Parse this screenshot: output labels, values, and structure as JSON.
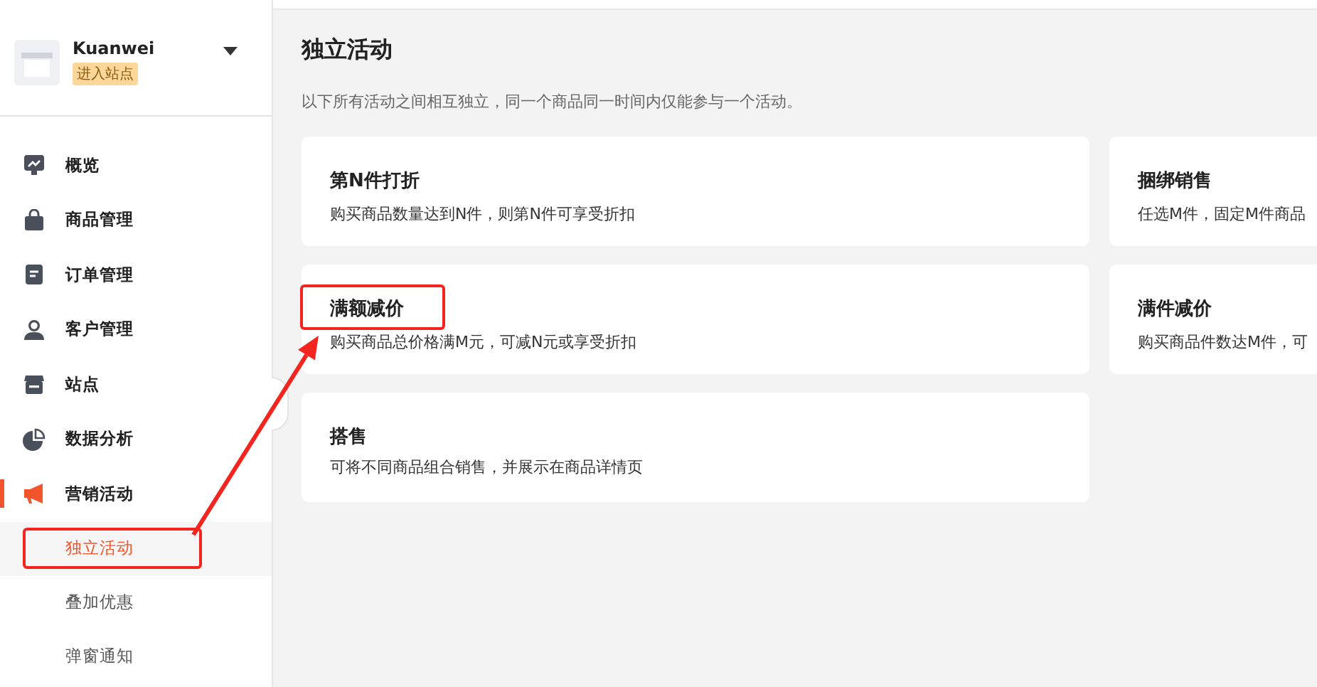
{
  "store": {
    "name": "Kuanwei",
    "badge": "进入站点"
  },
  "nav": [
    {
      "label": "概览",
      "kind": "chart",
      "selected": false
    },
    {
      "label": "商品管理",
      "kind": "bag",
      "selected": false
    },
    {
      "label": "订单管理",
      "kind": "doc",
      "selected": false
    },
    {
      "label": "客户管理",
      "kind": "user",
      "selected": false
    },
    {
      "label": "站点",
      "kind": "shop",
      "selected": false
    },
    {
      "label": "数据分析",
      "kind": "pie",
      "selected": false
    },
    {
      "label": "营销活动",
      "kind": "megaphone",
      "selected": true,
      "children": [
        {
          "label": "独立活动",
          "selected": true,
          "highlighted": true
        },
        {
          "label": "叠加优惠",
          "selected": false,
          "highlighted": false
        },
        {
          "label": "弹窗通知",
          "selected": false,
          "highlighted": false
        }
      ]
    }
  ],
  "page": {
    "title": "独立活动",
    "subtitle": "以下所有活动之间相互独立，同一个商品同一时间内仅能参与一个活动。"
  },
  "cards": [
    {
      "title": "第N件打折",
      "description": "购买商品数量达到N件，则第N件可享受折扣",
      "highlighted": false
    },
    {
      "title": "捆绑销售",
      "description": "任选M件，固定M件商品",
      "highlighted": false
    },
    {
      "title": "满额减价",
      "description": "购买商品总价格满M元，可减N元或享受折扣",
      "highlighted": true
    },
    {
      "title": "满件减价",
      "description": "购买商品件数达M件，可",
      "highlighted": false
    },
    {
      "title": "搭售",
      "description": "可将不同商品组合销售，并展示在商品详情页",
      "highlighted": false
    }
  ]
}
